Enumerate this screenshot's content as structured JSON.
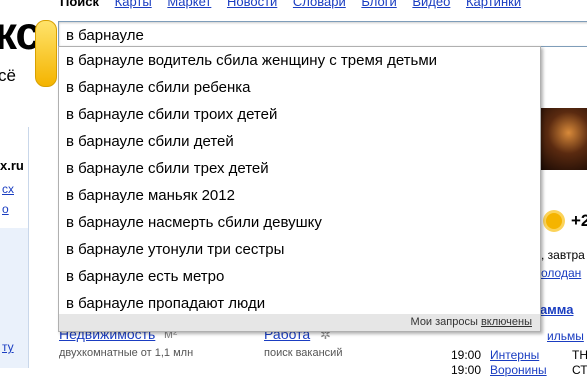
{
  "nav": {
    "items": [
      {
        "label": "Поиск",
        "current": true
      },
      {
        "label": "Карты"
      },
      {
        "label": "Маркет"
      },
      {
        "label": "Новости"
      },
      {
        "label": "Словари"
      },
      {
        "label": "Блоги"
      },
      {
        "label": "Видео"
      },
      {
        "label": "Картинки"
      }
    ]
  },
  "logo": {
    "text": "кс",
    "sub": "сё"
  },
  "search": {
    "value": "в барнауле"
  },
  "suggestions": [
    "в барнауле водитель сбила женщину с тремя детьми",
    "в барнауле сбили ребенка",
    "в барнауле сбили троих детей",
    "в барнауле сбили детей",
    "в барнауле сбили трех детей",
    "в барнауле маньяк 2012",
    "в барнауле насмерть сбили девушку",
    "в барнауле утонули три сестры",
    "в барнауле есть метро",
    "в барнауле пропадают люди"
  ],
  "dropdown_footer": {
    "prefix": "Мои запросы ",
    "link": "включены"
  },
  "left": {
    "domain": "x.ru",
    "link1": "сх",
    "link2": "о",
    "bottom": "ту"
  },
  "right": {
    "temp": "+2",
    "weather_line": ", завтра",
    "weather_link": "олодан",
    "program_label": "рамма",
    "films": "ильмы"
  },
  "bottom": {
    "realty": {
      "label": "Недвижимость",
      "sub": "двухкомнатные от 1,1 млн"
    },
    "jobs": {
      "label": "Работа",
      "sub": "поиск вакансий"
    }
  },
  "tv": [
    {
      "time": "19:00",
      "show": "Интерны",
      "extra": "ТН"
    },
    {
      "time": "19:00",
      "show": "Воронины",
      "extra": "СТ"
    }
  ]
}
